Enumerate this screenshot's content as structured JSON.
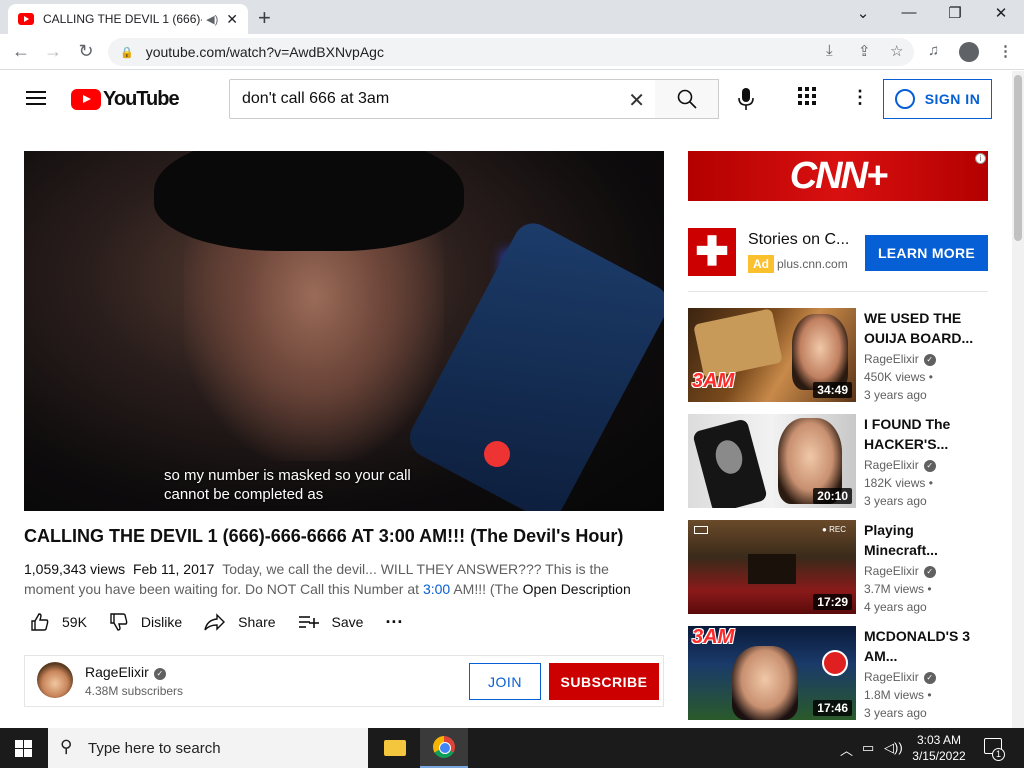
{
  "browser": {
    "tab_title": "CALLING THE DEVIL 1 (666)-",
    "url": "youtube.com/watch?v=AwdBXNvpAgc"
  },
  "youtube": {
    "logo_text": "YouTube",
    "search_value": "don't call 666 at 3am",
    "signin_label": "SIGN IN"
  },
  "video": {
    "caption_line1": "so my number is masked so your call",
    "caption_line2": "cannot be completed as",
    "title": "CALLING THE DEVIL 1 (666)-666-6666 AT 3:00 AM!!! (The Devil's Hour)",
    "views": "1,059,343 views",
    "date": "Feb 11, 2017",
    "desc_part1": "Today, we call the devil... WILL THEY ANSWER??? This is the moment you have been waiting for. Do NOT Call this Number at",
    "desc_link": "3:00",
    "desc_part2": "AM!!! (The",
    "open_description": "Open Description",
    "likes": "59K",
    "dislike_label": "Dislike",
    "share_label": "Share",
    "save_label": "Save"
  },
  "channel": {
    "name": "RageElixir",
    "subscribers": "4.38M subscribers",
    "join_label": "JOIN",
    "subscribe_label": "SUBSCRIBE"
  },
  "ad": {
    "banner_text": "CNN+",
    "title": "Stories on C...",
    "badge": "Ad",
    "domain": "plus.cnn.com",
    "cta": "LEARN MORE"
  },
  "recommendations": [
    {
      "title_line1": "WE USED THE",
      "title_line2": "OUIJA BOARD...",
      "channel": "RageElixir",
      "views": "450K views •",
      "age": "3 years ago",
      "duration": "34:49",
      "tag": "3AM"
    },
    {
      "title_line1": "I FOUND The",
      "title_line2": "HACKER'S...",
      "channel": "RageElixir",
      "views": "182K views •",
      "age": "3 years ago",
      "duration": "20:10"
    },
    {
      "title_line1": "Playing",
      "title_line2": "Minecraft...",
      "channel": "RageElixir",
      "views": "3.7M views •",
      "age": "4 years ago",
      "duration": "17:29"
    },
    {
      "title_line1": "MCDONALD'S 3",
      "title_line2": "AM...",
      "channel": "RageElixir",
      "views": "1.8M views •",
      "age": "3 years ago",
      "duration": "17:46",
      "tag": "3AM"
    }
  ],
  "taskbar": {
    "search_placeholder": "Type here to search",
    "time": "3:03 AM",
    "date": "3/15/2022",
    "notification_count": "1"
  }
}
